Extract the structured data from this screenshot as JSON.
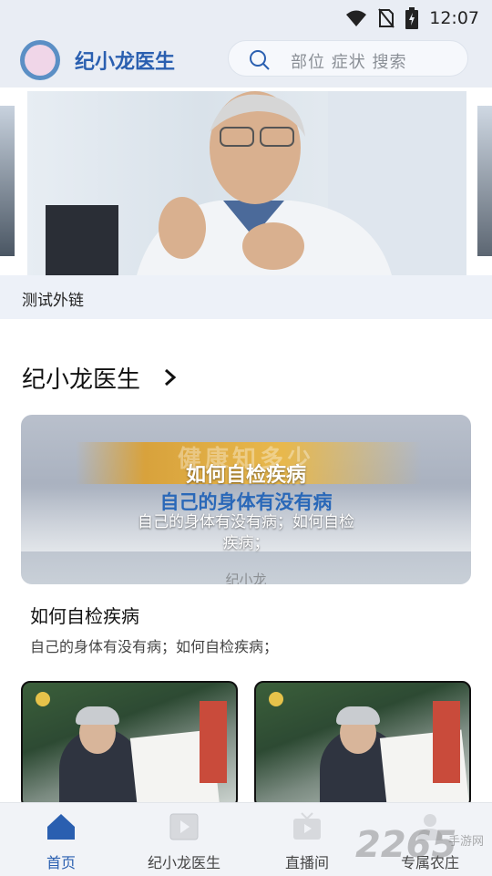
{
  "status_bar": {
    "time": "12:07",
    "icons": [
      "wifi-icon",
      "no-sim-icon",
      "battery-icon"
    ]
  },
  "header": {
    "app_name": "纪小龙医生",
    "search_placeholder": "部位 症状 搜索",
    "accent_color": "#2a5fb0"
  },
  "banner": {
    "caption": "测试外链"
  },
  "section": {
    "title": "纪小龙医生"
  },
  "featured": {
    "image_text": {
      "ghost_heading": "健康知多少",
      "subheading": "自己的身体有没有病",
      "name_text": "纪小龙"
    },
    "overlay_title": "如何自检疾病",
    "overlay_desc": "自己的身体有没有病；如何自检疾病；",
    "title": "如何自检疾病",
    "desc": "自己的身体有没有病；如何自检疾病；"
  },
  "thumbnails": [
    {
      "icon": "video-thumbnail"
    },
    {
      "icon": "video-thumbnail"
    }
  ],
  "bottom_nav": {
    "items": [
      {
        "label": "首页",
        "icon": "home-icon",
        "active": true
      },
      {
        "label": "纪小龙医生",
        "icon": "film-icon",
        "active": false
      },
      {
        "label": "直播间",
        "icon": "tv-icon",
        "active": false
      },
      {
        "label": "专属农庄",
        "icon": "user-icon",
        "active": false
      }
    ]
  },
  "watermark": {
    "text": "2265",
    "small": "手游网"
  }
}
